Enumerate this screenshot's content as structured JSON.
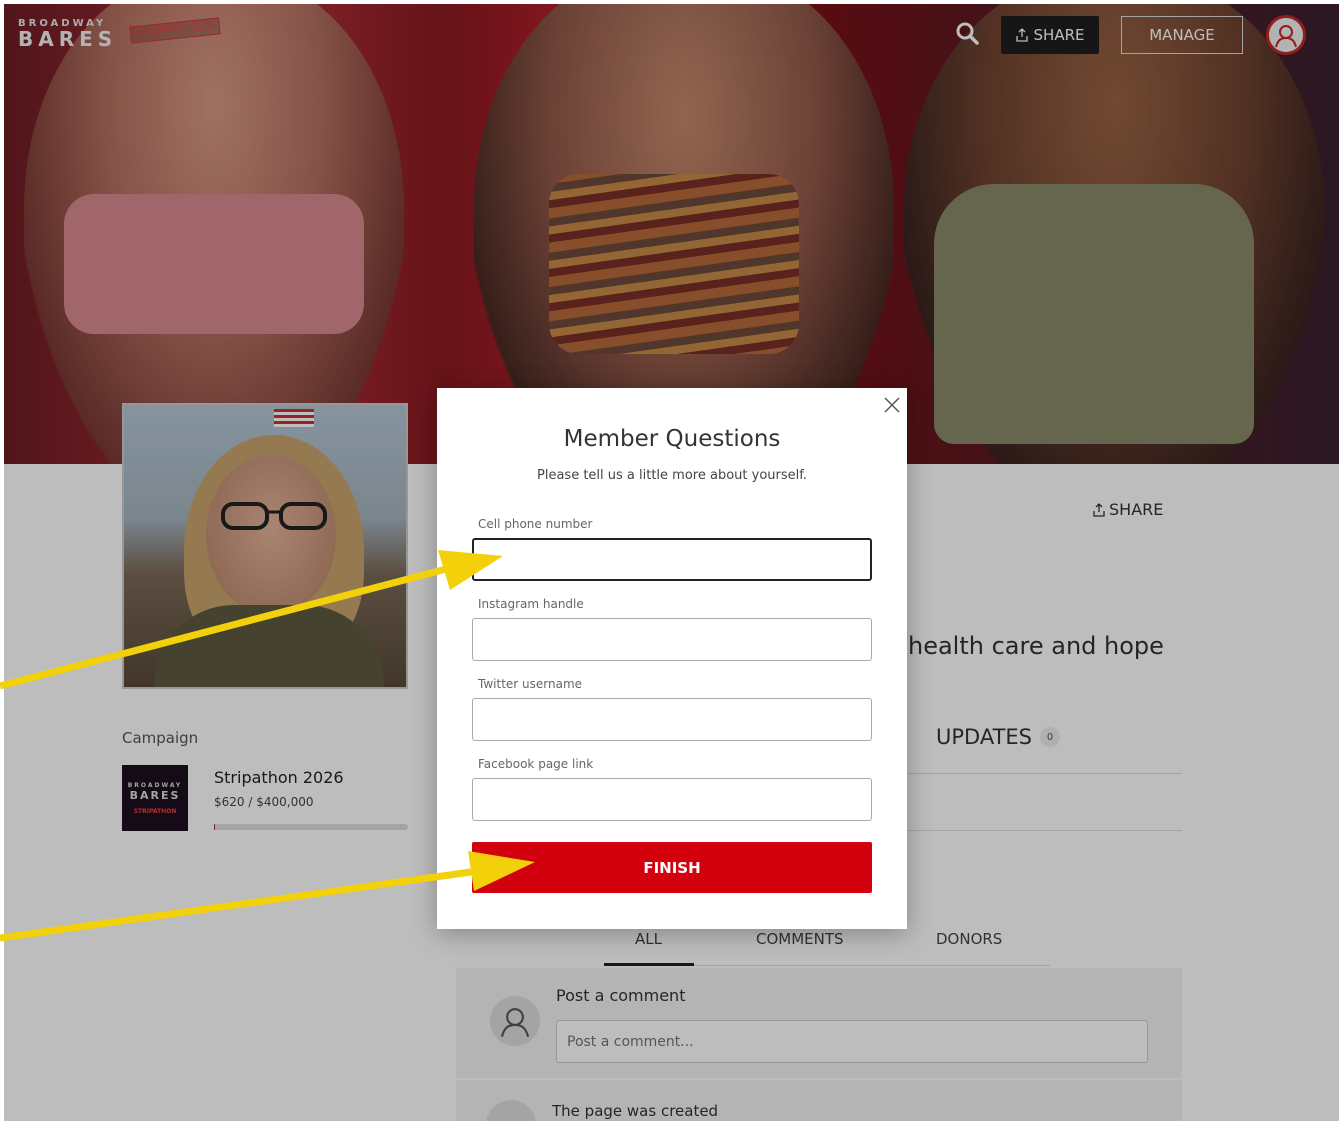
{
  "header": {
    "logo_line1": "BROADWAY",
    "logo_line2": "BARES",
    "logo_badge": "STRIPATHON",
    "share_label": "SHARE",
    "manage_label": "MANAGE"
  },
  "profile": {
    "share_label": "SHARE",
    "tagline_visible": "health care and hope"
  },
  "campaign": {
    "label": "Campaign",
    "thumb_line1": "BROADWAY",
    "thumb_line2": "BARES",
    "thumb_line3": "STRIPATHON",
    "name": "Stripathon 2026",
    "amount": "$620 / $400,000",
    "progress_fraction": 0.00155
  },
  "updates": {
    "label": "UPDATES",
    "count": "0"
  },
  "tabs": {
    "all": "ALL",
    "comments": "COMMENTS",
    "donors": "DONORS"
  },
  "comments": {
    "title": "Post a comment",
    "placeholder": "Post a comment..."
  },
  "activity": {
    "created": "The page was created"
  },
  "modal": {
    "title": "Member Questions",
    "subtitle": "Please tell us a little more about yourself.",
    "fields": [
      {
        "label": "Cell phone number",
        "value": ""
      },
      {
        "label": "Instagram handle",
        "value": ""
      },
      {
        "label": "Twitter username",
        "value": ""
      },
      {
        "label": "Facebook page link",
        "value": ""
      }
    ],
    "finish_label": "FINISH"
  },
  "colors": {
    "accent": "#d3000e",
    "annotation_arrow": "#f2d10a"
  }
}
